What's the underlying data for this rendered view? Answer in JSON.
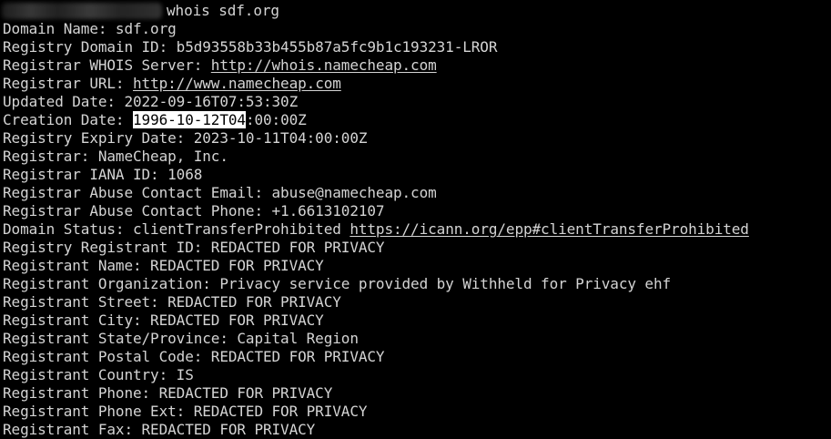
{
  "terminal": {
    "command": "whois sdf.org",
    "lines": {
      "domain_name": "Domain Name: sdf.org",
      "registry_domain_id": "Registry Domain ID: b5d93558b33b455b87a5fc9b1c193231-LROR",
      "registrar_whois_label": "Registrar WHOIS Server: ",
      "registrar_whois_url": "http://whois.namecheap.com",
      "registrar_url_label": "Registrar URL: ",
      "registrar_url": "http://www.namecheap.com",
      "updated_date": "Updated Date: 2022-09-16T07:53:30Z",
      "creation_label": "Creation Date: ",
      "creation_selected": "1996-10-12T04",
      "creation_rest": ":00:00Z",
      "expiry_date": "Registry Expiry Date: 2023-10-11T04:00:00Z",
      "registrar": "Registrar: NameCheap, Inc.",
      "iana_id": "Registrar IANA ID: 1068",
      "abuse_email": "Registrar Abuse Contact Email: abuse@namecheap.com",
      "abuse_phone": "Registrar Abuse Contact Phone: +1.6613102107",
      "status_label": "Domain Status: clientTransferProhibited ",
      "status_url": "https://icann.org/epp#clientTransferProhibited",
      "registrant_id": "Registry Registrant ID: REDACTED FOR PRIVACY",
      "registrant_name": "Registrant Name: REDACTED FOR PRIVACY",
      "registrant_org": "Registrant Organization: Privacy service provided by Withheld for Privacy ehf",
      "registrant_street": "Registrant Street: REDACTED FOR PRIVACY",
      "registrant_city": "Registrant City: REDACTED FOR PRIVACY",
      "registrant_state": "Registrant State/Province: Capital Region",
      "registrant_postal": "Registrant Postal Code: REDACTED FOR PRIVACY",
      "registrant_country": "Registrant Country: IS",
      "registrant_phone": "Registrant Phone: REDACTED FOR PRIVACY",
      "registrant_phone_ext": "Registrant Phone Ext: REDACTED FOR PRIVACY",
      "registrant_fax": "Registrant Fax: REDACTED FOR PRIVACY"
    }
  },
  "colors": {
    "background": "#000000",
    "text": "#d4d4d4",
    "selection_bg": "#ffffff",
    "selection_fg": "#000000"
  }
}
